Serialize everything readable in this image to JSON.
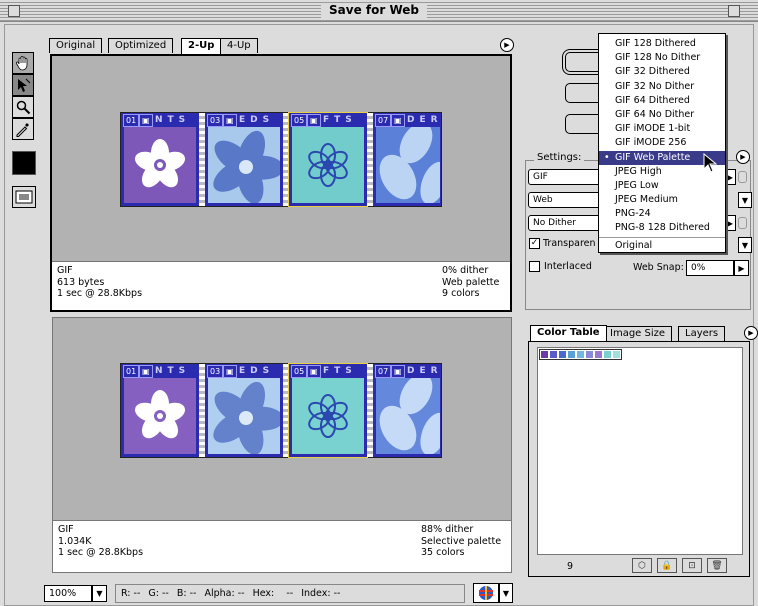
{
  "window": {
    "title": "Save for Web"
  },
  "tabs": [
    {
      "label": "Original"
    },
    {
      "label": "Optimized"
    },
    {
      "label": "2-Up"
    },
    {
      "label": "4-Up"
    }
  ],
  "preview_top": {
    "info_left": [
      "GIF",
      "613 bytes",
      "1 sec @ 28.8Kbps"
    ],
    "info_right": [
      "0% dither",
      "Web palette",
      "9 colors"
    ]
  },
  "preview_bottom": {
    "info_left": [
      "GIF",
      "1.034K",
      "1 sec @ 28.8Kbps"
    ],
    "info_right": [
      "88% dither",
      "Selective palette",
      "35 colors"
    ]
  },
  "strip": {
    "segments": [
      {
        "num": "01",
        "text": "NTS"
      },
      {
        "num": "03",
        "text": "EDS"
      },
      {
        "num": "05",
        "text": "FTS"
      },
      {
        "num": "07",
        "text": "DER"
      }
    ]
  },
  "settings": {
    "label": "Settings:",
    "format": "GIF",
    "palette": "Web",
    "dither": "No Dither",
    "transparency_label": "Transparen",
    "transparency_checked": true,
    "interlaced_label": "Interlaced",
    "interlaced_checked": false,
    "web_snap_label": "Web Snap:",
    "web_snap_value": "0%"
  },
  "menu": {
    "items": [
      "GIF 128 Dithered",
      "GIF 128 No Dither",
      "GIF 32 Dithered",
      "GIF 32 No Dither",
      "GIF 64 Dithered",
      "GIF 64 No Dither",
      "GIF iMODE 1-bit",
      "GIF iMODE 256",
      "GIF Web Palette",
      "JPEG High",
      "JPEG Low",
      "JPEG Medium",
      "PNG-24",
      "PNG-8 128 Dithered",
      "Original"
    ],
    "selected": "GIF Web Palette"
  },
  "color_panel": {
    "tabs": [
      "Color Table",
      "Image Size",
      "Layers"
    ],
    "color_count": "9",
    "swatch_colors": [
      "#6a3aa8",
      "#5a5ac8",
      "#4a6ad0",
      "#5aa0d8",
      "#70b8e0",
      "#8a8ad8",
      "#9a7ad0",
      "#7ad0d0",
      "#a0e0e0"
    ]
  },
  "status_bar": {
    "zoom": "100%",
    "r_label": "R:",
    "r_value": "--",
    "g_label": "G:",
    "g_value": "--",
    "b_label": "B:",
    "b_value": "--",
    "alpha_label": "Alpha:",
    "alpha_value": "--",
    "hex_label": "Hex:",
    "hex_value": "--",
    "index_label": "Index:",
    "index_value": "--"
  },
  "colors": {
    "strip_bg": "#2b2bb0",
    "highlight": "#3a3a8a"
  }
}
